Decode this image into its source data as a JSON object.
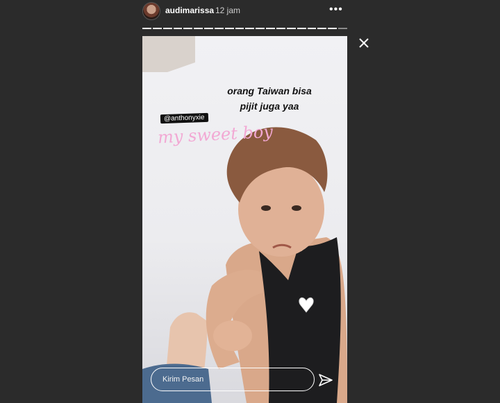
{
  "header": {
    "username": "audimarissa",
    "time": "12 jam",
    "more_label": "•••"
  },
  "progress": {
    "segments_seen": 19,
    "segments_total": 20
  },
  "story": {
    "caption_line1": "orang Taiwan bisa",
    "caption_line2": "pijit juga yaa",
    "mention": "@anthonyxie",
    "handwritten": "my sweet boy"
  },
  "reply": {
    "placeholder": "Kirim Pesan"
  }
}
